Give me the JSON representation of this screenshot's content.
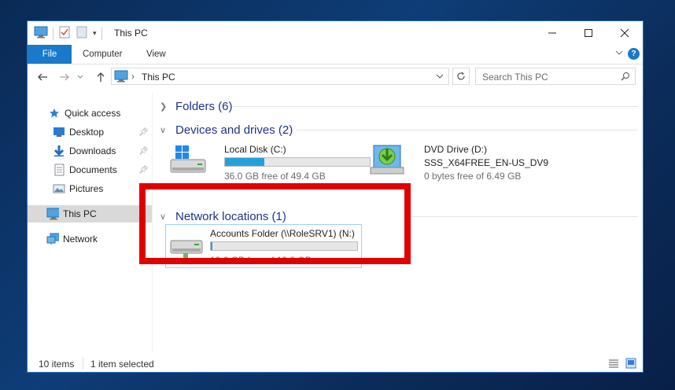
{
  "window": {
    "title": "This PC"
  },
  "ribbon": {
    "file": "File",
    "tabs": [
      "Computer",
      "View"
    ],
    "help": "?"
  },
  "address": {
    "path": "This PC",
    "separator": "›"
  },
  "search": {
    "placeholder": "Search This PC"
  },
  "sidebar": {
    "items": [
      {
        "label": "Quick access",
        "icon": "star-icon"
      },
      {
        "label": "Desktop",
        "icon": "desktop-icon",
        "pinned": true
      },
      {
        "label": "Downloads",
        "icon": "download-icon",
        "pinned": true
      },
      {
        "label": "Documents",
        "icon": "document-icon",
        "pinned": true
      },
      {
        "label": "Pictures",
        "icon": "pictures-icon"
      },
      {
        "label": "This PC",
        "icon": "computer-icon",
        "selected": true
      },
      {
        "label": "Network",
        "icon": "network-icon"
      }
    ]
  },
  "groups": {
    "folders": "Folders (6)",
    "devices": "Devices and drives (2)",
    "network": "Network locations (1)"
  },
  "drives": [
    {
      "name": "Local Disk (C:)",
      "free": "36.0 GB free of 49.4 GB",
      "used_fraction": 0.27
    },
    {
      "name": "DVD Drive (D:)",
      "label": "SSS_X64FREE_EN-US_DV9",
      "free": "0 bytes free of 6.49 GB"
    }
  ],
  "network_drive": {
    "name": "Accounts Folder (\\\\RoleSRV1) (N:)",
    "free": "19.6 GB free of 19.8 GB",
    "used_fraction": 0.01
  },
  "status": {
    "items": "10 items",
    "selected": "1 item selected"
  },
  "colors": {
    "accent": "#1979ca",
    "bar_fill": "#26a0da",
    "highlight": "#e10000"
  }
}
